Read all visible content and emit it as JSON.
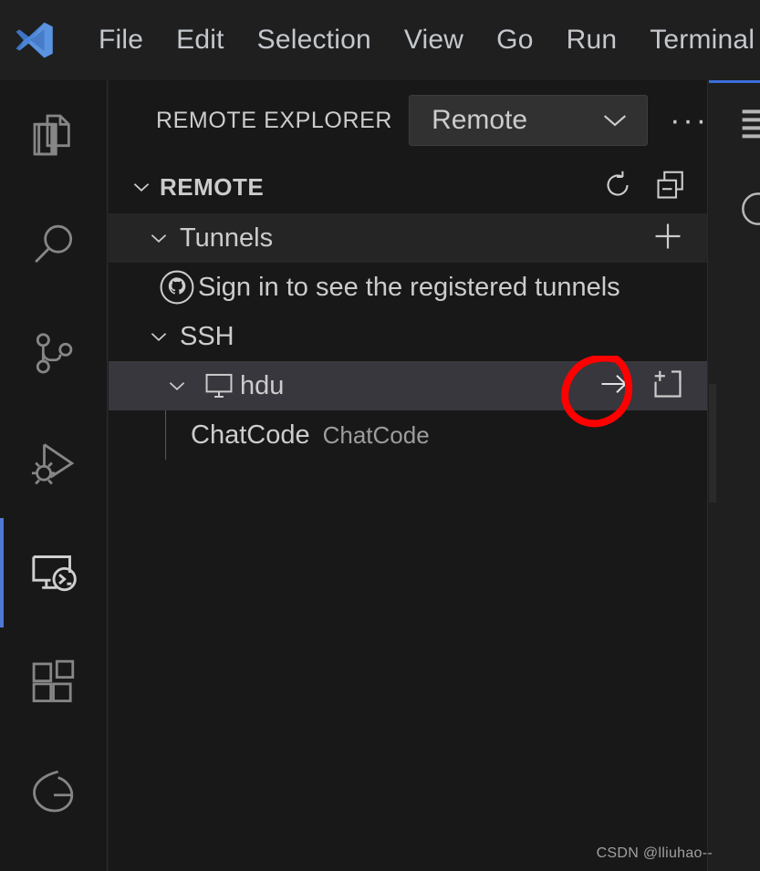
{
  "app": {
    "logo_icon": "vscode-logo",
    "menu": [
      {
        "label": "File"
      },
      {
        "label": "Edit"
      },
      {
        "label": "Selection"
      },
      {
        "label": "View"
      },
      {
        "label": "Go"
      },
      {
        "label": "Run"
      },
      {
        "label": "Terminal"
      }
    ]
  },
  "activity_bar": {
    "items": [
      {
        "name": "explorer",
        "icon": "files-icon",
        "active": false
      },
      {
        "name": "search",
        "icon": "search-icon",
        "active": false
      },
      {
        "name": "source-control",
        "icon": "source-control-icon",
        "active": false
      },
      {
        "name": "run-and-debug",
        "icon": "run-debug-icon",
        "active": false
      },
      {
        "name": "remote-explorer",
        "icon": "remote-explorer-icon",
        "active": true
      },
      {
        "name": "extensions",
        "icon": "extensions-icon",
        "active": false
      },
      {
        "name": "gitlens",
        "icon": "gitlens-icon",
        "active": false
      }
    ]
  },
  "sidebar": {
    "title": "REMOTE EXPLORER",
    "view_select": {
      "value": "Remote",
      "chevron_icon": "chevron-down-icon"
    },
    "more_actions_label": "···",
    "section": {
      "label": "REMOTE",
      "twisty_icon": "chevron-down-icon",
      "actions": [
        {
          "name": "refresh",
          "icon": "refresh-icon"
        },
        {
          "name": "collapse-all",
          "icon": "collapse-all-icon"
        }
      ]
    },
    "tree": [
      {
        "id": "tunnels",
        "label": "Tunnels",
        "kind": "group",
        "twisty_icon": "chevron-down-icon",
        "actions": [
          {
            "name": "create-tunnel",
            "icon": "plus-icon"
          }
        ]
      },
      {
        "id": "tunnels-signin",
        "label": "Sign in to see the registered tunnels",
        "kind": "message",
        "icon": "github-icon"
      },
      {
        "id": "ssh",
        "label": "SSH",
        "kind": "group",
        "twisty_icon": "chevron-down-icon",
        "actions": []
      },
      {
        "id": "hdu",
        "label": "hdu",
        "kind": "host",
        "selected": true,
        "twisty_icon": "chevron-down-icon",
        "icon": "remote-host-icon",
        "actions": [
          {
            "name": "connect-in-current-window",
            "icon": "arrow-right-icon"
          },
          {
            "name": "connect-in-new-window",
            "icon": "new-window-icon"
          }
        ]
      },
      {
        "id": "chatcode",
        "label": "ChatCode",
        "description": "ChatCode",
        "kind": "folder"
      }
    ]
  },
  "editor": {
    "menu_icon": "list-icon",
    "circle_icon": "circle-icon"
  },
  "annotation": {
    "shape": "hand-drawn-circle",
    "color": "#ff0000",
    "targets": "connect-in-current-window"
  },
  "watermark": "CSDN @lliuhao--",
  "colors": {
    "accent": "#4d79d4",
    "titlebar_bg": "#1f1f1f",
    "sidebar_bg": "#181818",
    "row_selected_bg": "#37373d",
    "row_group_bg": "#252526",
    "text": "#cccccc",
    "text_dim": "#9d9d9d",
    "annotation_red": "#ff0000"
  }
}
